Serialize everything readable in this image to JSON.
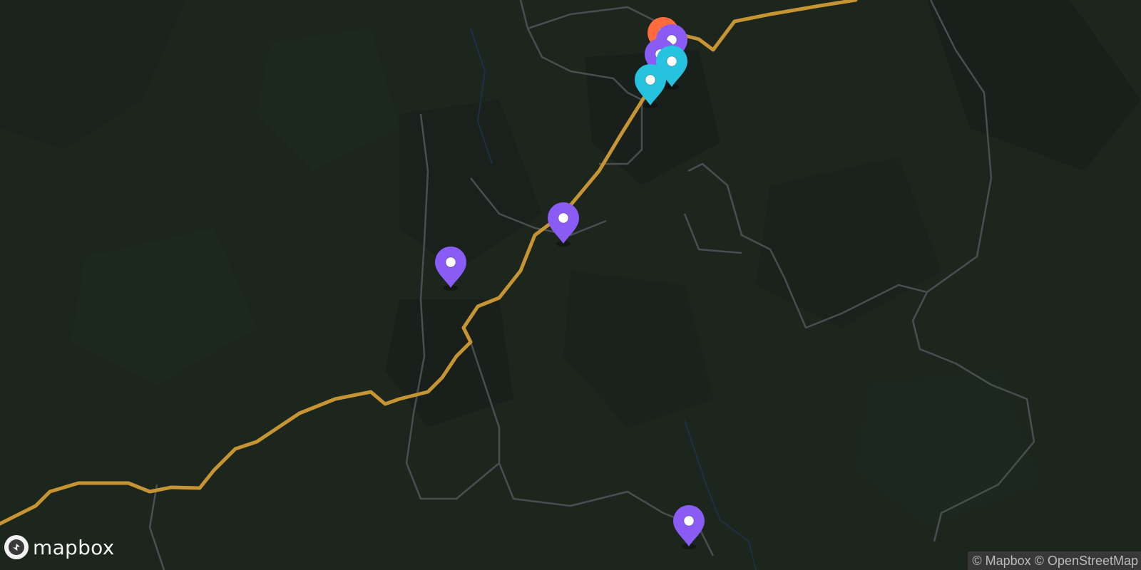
{
  "map": {
    "background": "#1c261d",
    "road_color": "#c79433",
    "secondary_road_color": "#4a4d52",
    "marker_colors": {
      "purple": "#8a5cf5",
      "cyan": "#26c3e0",
      "orange": "#ff6b3d"
    },
    "markers": [
      {
        "name": "marker-orange-1",
        "color": "orange",
        "icon": "map-pin-icon"
      },
      {
        "name": "marker-purple-1",
        "color": "purple",
        "icon": "map-pin-icon"
      },
      {
        "name": "marker-purple-2",
        "color": "purple",
        "icon": "map-pin-icon"
      },
      {
        "name": "marker-cyan-1",
        "color": "cyan",
        "icon": "map-pin-icon"
      },
      {
        "name": "marker-cyan-2",
        "color": "cyan",
        "icon": "map-pin-icon"
      },
      {
        "name": "marker-purple-3",
        "color": "purple",
        "icon": "map-pin-icon"
      },
      {
        "name": "marker-purple-4",
        "color": "purple",
        "icon": "map-pin-icon"
      },
      {
        "name": "marker-purple-5",
        "color": "purple",
        "icon": "map-pin-icon"
      }
    ]
  },
  "logo": {
    "text": "mapbox",
    "icon": "mapbox-logo-icon"
  },
  "attribution": {
    "mapbox": "© Mapbox",
    "osm": "© OpenStreetMap"
  }
}
